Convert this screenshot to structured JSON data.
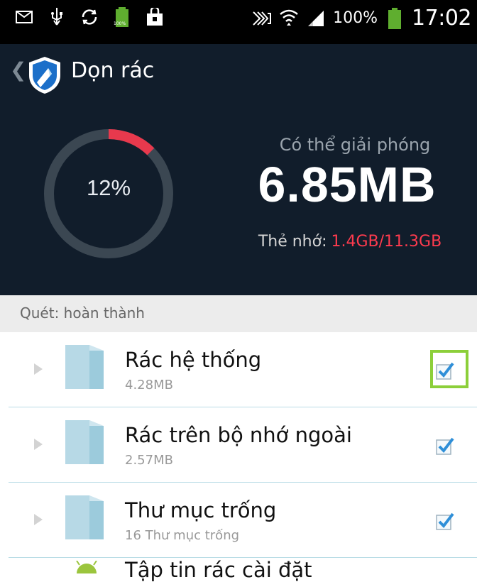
{
  "status_bar": {
    "battery_percent": "100%",
    "time": "17:02",
    "small_battery_label": "100%"
  },
  "header": {
    "title": "Dọn rác",
    "progress_percent": "12%",
    "release_label": "Có thể giải phóng",
    "release_size": "6.85MB",
    "storage_label": "Thẻ nhớ:",
    "storage_value": "1.4GB/11.3GB",
    "accent_red": "#ff3b4e",
    "header_bg": "#111d2b"
  },
  "scan": {
    "status": "Quét: hoàn thành"
  },
  "items": [
    {
      "title": "Rác hệ thống",
      "subtitle": "4.28MB",
      "checked": true
    },
    {
      "title": "Rác trên bộ nhớ ngoài",
      "subtitle": "2.57MB",
      "checked": true
    },
    {
      "title": "Thư mục trống",
      "subtitle": "16 Thư mục trống",
      "checked": true
    }
  ],
  "partial_item": {
    "title": "Tập tin rác cài đặt"
  }
}
